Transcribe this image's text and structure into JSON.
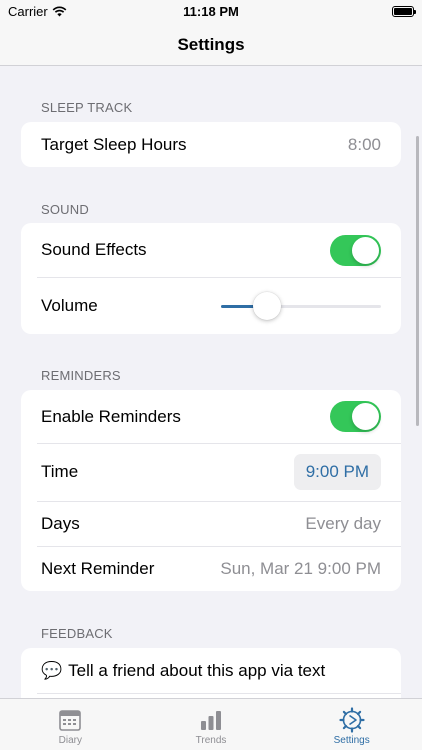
{
  "status_bar": {
    "carrier": "Carrier",
    "time": "11:18 PM"
  },
  "nav": {
    "title": "Settings"
  },
  "sections": {
    "sleep_track": {
      "header": "SLEEP TRACK",
      "target_sleep_hours_label": "Target Sleep Hours",
      "target_sleep_hours_value": "8:00"
    },
    "sound": {
      "header": "SOUND",
      "sound_effects_label": "Sound Effects",
      "sound_effects_on": true,
      "volume_label": "Volume",
      "volume_level": 0.29
    },
    "reminders": {
      "header": "REMINDERS",
      "enable_label": "Enable Reminders",
      "enable_on": true,
      "time_label": "Time",
      "time_value": "9:00 PM",
      "days_label": "Days",
      "days_value": "Every day",
      "next_label": "Next Reminder",
      "next_value": "Sun, Mar 21 9:00 PM"
    },
    "feedback": {
      "header": "FEEDBACK",
      "tell_friend_icon": "speech-bubble-icon",
      "tell_friend_label": "Tell a friend about this app via text"
    }
  },
  "tabs": [
    {
      "label": "Diary",
      "icon": "calendar-icon",
      "active": false
    },
    {
      "label": "Trends",
      "icon": "bar-chart-icon",
      "active": false
    },
    {
      "label": "Settings",
      "icon": "gear-icon",
      "active": true
    }
  ],
  "colors": {
    "accent": "#2f6ea5",
    "toggle_on": "#34c759",
    "background": "#f2f2f7"
  }
}
